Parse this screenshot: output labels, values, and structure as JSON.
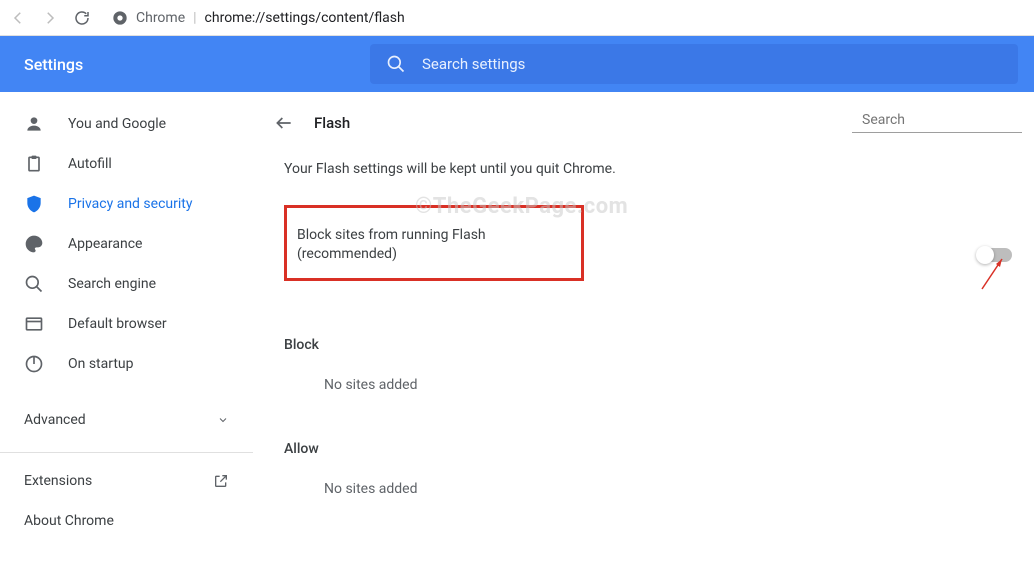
{
  "toolbar": {
    "url_label": "Chrome",
    "url_path": "chrome://settings/content/flash"
  },
  "header": {
    "title": "Settings",
    "search_placeholder": "Search settings"
  },
  "sidebar": {
    "items": [
      {
        "label": "You and Google"
      },
      {
        "label": "Autofill"
      },
      {
        "label": "Privacy and security"
      },
      {
        "label": "Appearance"
      },
      {
        "label": "Search engine"
      },
      {
        "label": "Default browser"
      },
      {
        "label": "On startup"
      }
    ],
    "advanced": "Advanced",
    "extensions": "Extensions",
    "about": "About Chrome"
  },
  "content": {
    "title": "Flash",
    "search_placeholder": "Search",
    "info": "Your Flash settings will be kept until you quit Chrome.",
    "toggle_label": "Block sites from running Flash (recommended)",
    "block_heading": "Block",
    "block_empty": "No sites added",
    "allow_heading": "Allow",
    "allow_empty": "No sites added"
  },
  "watermark": "©TheGeekPage.com"
}
